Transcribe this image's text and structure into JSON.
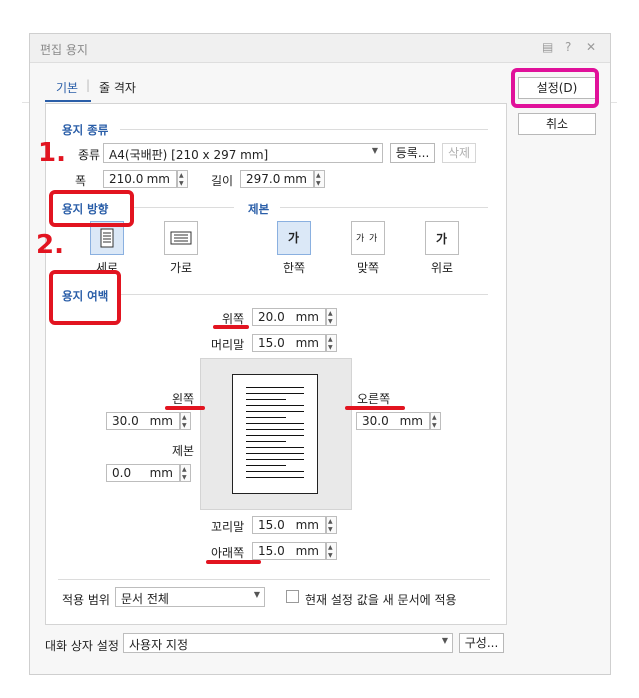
{
  "window": {
    "title": "편집 용지"
  },
  "tabs": [
    {
      "label": "기본"
    },
    {
      "label": "줄 격자"
    }
  ],
  "buttons": {
    "ok": "설정(D)",
    "cancel": "취소",
    "register": "등록...",
    "delete": "삭제",
    "config": "구성..."
  },
  "paper_type": {
    "section": "용지 종류",
    "kind_label": "종류",
    "kind_value": "A4(국배판) [210 x 297 mm]",
    "width_label": "폭",
    "width_value": "210.0",
    "height_label": "길이",
    "height_value": "297.0",
    "unit": "mm"
  },
  "orientation": {
    "section": "용지 방향",
    "portrait": "세로",
    "landscape": "가로"
  },
  "binding": {
    "section": "제본",
    "single": "한쪽",
    "facing": "맞쪽",
    "top": "위로",
    "glyph": "가"
  },
  "margins": {
    "section": "용지 여백",
    "top_label": "위쪽",
    "top_value": "20.0",
    "header_label": "머리말",
    "header_value": "15.0",
    "left_label": "왼쪽",
    "left_value": "30.0",
    "right_label": "오른쪽",
    "right_value": "30.0",
    "gutter_label": "제본",
    "gutter_value": "0.0",
    "footer_label": "꼬리말",
    "footer_value": "15.0",
    "bottom_label": "아래쪽",
    "bottom_value": "15.0",
    "unit": "mm"
  },
  "scope": {
    "label": "적용 범위",
    "value": "문서 전체",
    "checkbox_label": "현재 설정 값을 새 문서에 적용"
  },
  "dialog_settings": {
    "label": "대화 상자 설정",
    "value": "사용자 지정"
  },
  "annotations": {
    "step1": "1.",
    "step2": "2."
  },
  "colors": {
    "accent": "#2a5ea8",
    "annotation_red": "#e21420",
    "highlight_magenta": "#e0119a"
  }
}
